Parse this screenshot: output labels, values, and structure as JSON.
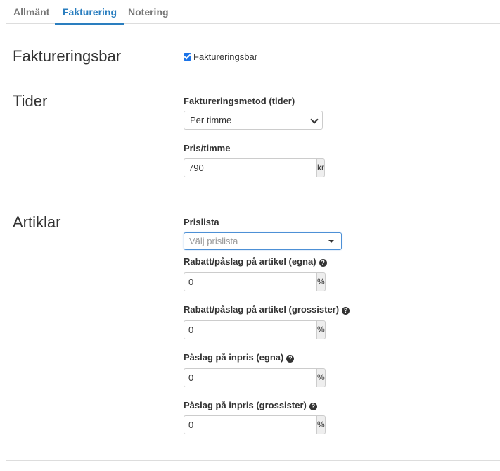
{
  "tabs": [
    {
      "label": "Allmänt"
    },
    {
      "label": "Fakturering"
    },
    {
      "label": "Notering"
    }
  ],
  "active_tab_index": 1,
  "sections": {
    "fakturering": {
      "title": "Faktureringsbar",
      "checkbox_label": "Faktureringsbar",
      "checked": true
    },
    "tider": {
      "title": "Tider",
      "method_label": "Faktureringsmetod (tider)",
      "method_value": "Per timme",
      "price_label": "Pris/timme",
      "price_value": "790",
      "price_unit": "kr"
    },
    "artiklar": {
      "title": "Artiklar",
      "pricelist_label": "Prislista",
      "pricelist_placeholder": "Välj prislista",
      "fields": [
        {
          "label": "Rabatt/påslag på artikel (egna)",
          "value": "0",
          "unit": "%"
        },
        {
          "label": "Rabatt/påslag på artikel (grossister)",
          "value": "0",
          "unit": "%"
        },
        {
          "label": "Påslag på inpris (egna)",
          "value": "0",
          "unit": "%"
        },
        {
          "label": "Påslag på inpris (grossister)",
          "value": "0",
          "unit": "%"
        }
      ],
      "help_icon": "question-circle-icon"
    }
  },
  "colors": {
    "accent": "#2a7ebf",
    "checkbox": "#1a73e8",
    "divider": "#dddddd"
  }
}
